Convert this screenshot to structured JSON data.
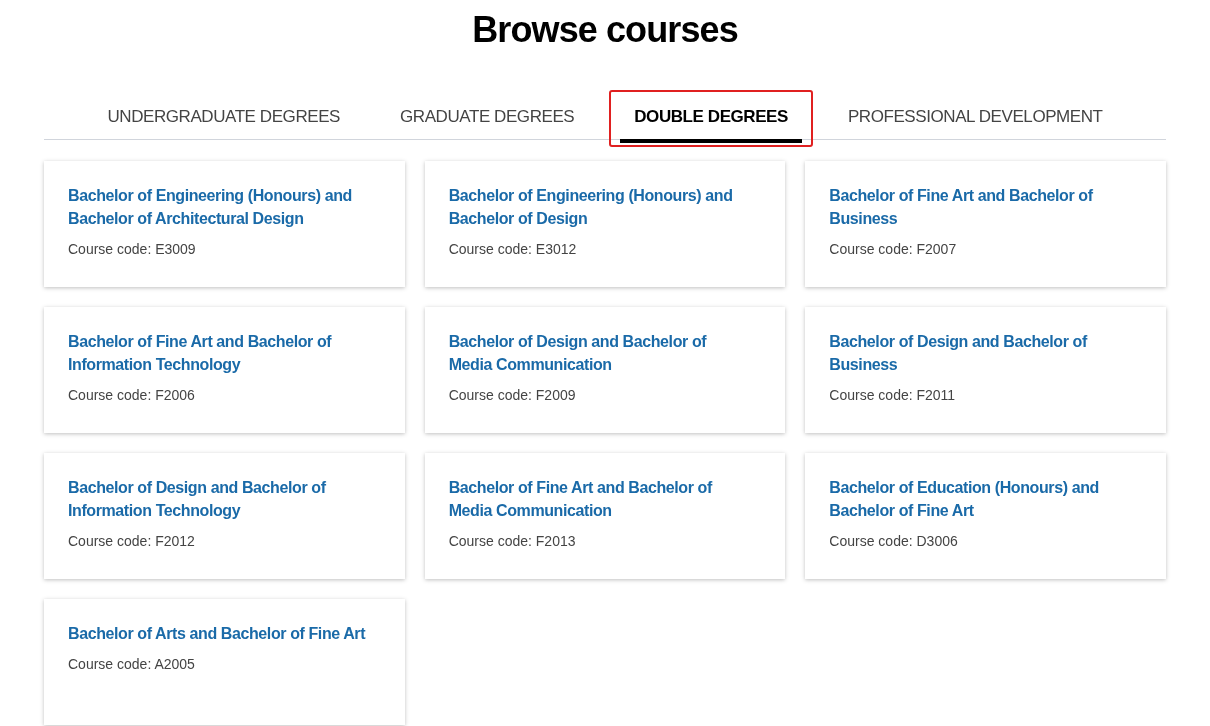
{
  "title": "Browse courses",
  "tabs": [
    {
      "label": "UNDERGRADUATE DEGREES",
      "selected": false,
      "highlighted": false
    },
    {
      "label": "GRADUATE DEGREES",
      "selected": false,
      "highlighted": false
    },
    {
      "label": "DOUBLE DEGREES",
      "selected": true,
      "highlighted": true
    },
    {
      "label": "PROFESSIONAL DEVELOPMENT",
      "selected": false,
      "highlighted": false
    }
  ],
  "courses": [
    {
      "title": "Bachelor of Engineering (Honours) and Bachelor of Architectural Design",
      "code": "Course code: E3009"
    },
    {
      "title": "Bachelor of Engineering (Honours) and Bachelor of Design",
      "code": "Course code: E3012"
    },
    {
      "title": "Bachelor of Fine Art and Bachelor of Business",
      "code": "Course code: F2007"
    },
    {
      "title": "Bachelor of Fine Art and Bachelor of Information Technology",
      "code": "Course code: F2006"
    },
    {
      "title": "Bachelor of Design and Bachelor of Media Communication",
      "code": "Course code: F2009"
    },
    {
      "title": "Bachelor of Design and Bachelor of Business",
      "code": "Course code: F2011"
    },
    {
      "title": "Bachelor of Design and Bachelor of Information Technology",
      "code": "Course code: F2012"
    },
    {
      "title": "Bachelor of Fine Art and Bachelor of Media Communication",
      "code": "Course code: F2013"
    },
    {
      "title": "Bachelor of Education (Honours) and Bachelor of Fine Art",
      "code": "Course code: D3006"
    },
    {
      "title": "Bachelor of Arts and Bachelor of Fine Art",
      "code": "Course code: A2005"
    }
  ]
}
